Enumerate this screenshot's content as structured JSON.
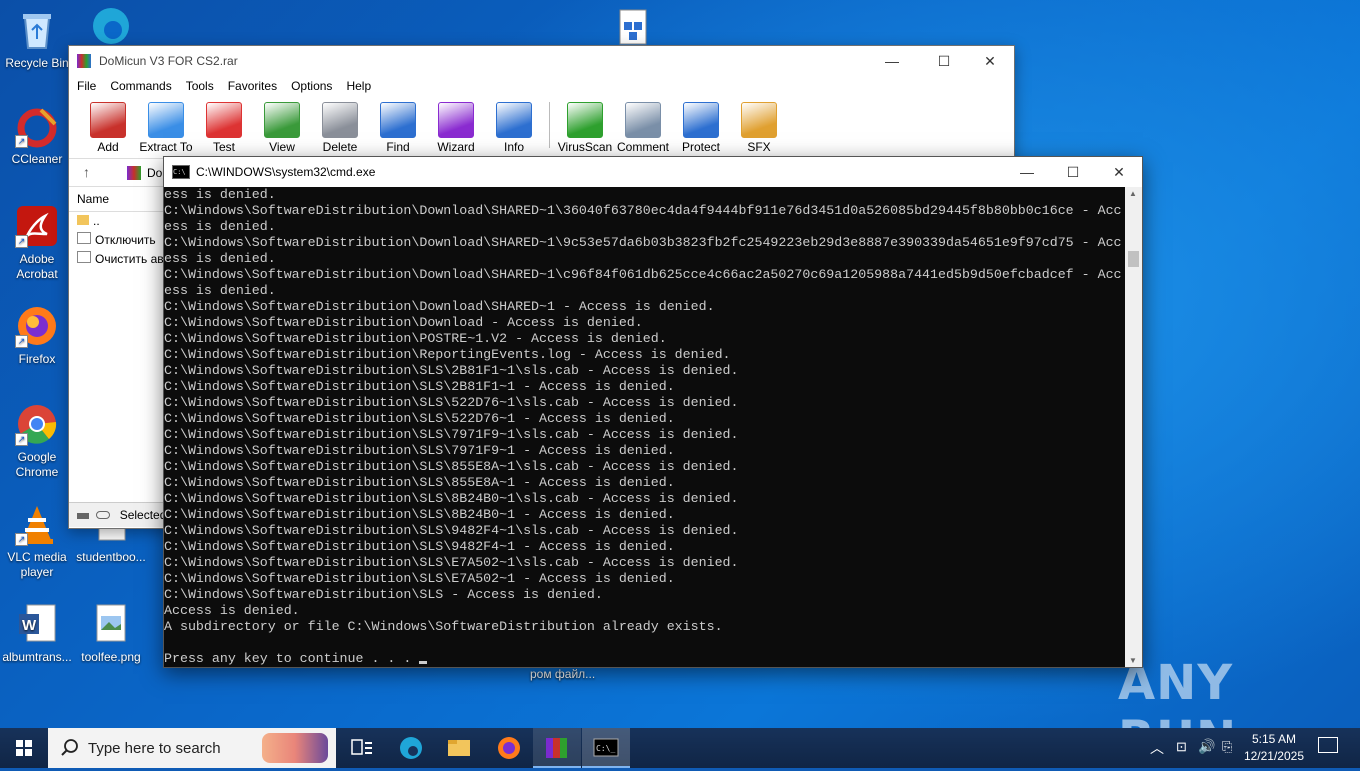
{
  "desktop": {
    "icons": [
      {
        "label": "Recycle Bin",
        "color": "#9fd0ff"
      },
      {
        "label": "CCleaner",
        "color": "#d32b2b"
      },
      {
        "label": "Adobe Acrobat",
        "color": "#c4170f"
      },
      {
        "label": "Firefox",
        "color": "#ff7a1a"
      },
      {
        "label": "Google Chrome",
        "color": "#34a853"
      },
      {
        "label": "VLC media player",
        "color": "#f08000"
      },
      {
        "label": "studentboo...",
        "color": "#ffffff"
      },
      {
        "label": "albumtrans...",
        "color": "#2b579a"
      },
      {
        "label": "toolfee.png",
        "color": "#ffffff"
      }
    ],
    "bg_caption": "ром файл...",
    "watermark": "ANY RUN"
  },
  "winrar": {
    "title": "DoMicun V3 FOR CS2.rar",
    "menu": [
      "File",
      "Commands",
      "Tools",
      "Favorites",
      "Options",
      "Help"
    ],
    "toolbar": [
      {
        "label": "Add",
        "icon": "add-archive-icon",
        "color": "#c8312b"
      },
      {
        "label": "Extract To",
        "icon": "extract-folder-icon",
        "color": "#3a8ee6"
      },
      {
        "label": "Test",
        "icon": "test-clipboard-icon",
        "color": "#d33"
      },
      {
        "label": "View",
        "icon": "view-book-icon",
        "color": "#3a9a3a"
      },
      {
        "label": "Delete",
        "icon": "trash-icon",
        "color": "#8a8f99"
      },
      {
        "label": "Find",
        "icon": "magnifier-icon",
        "color": "#2d6fd0"
      },
      {
        "label": "Wizard",
        "icon": "wand-icon",
        "color": "#8a2bd0"
      },
      {
        "label": "Info",
        "icon": "info-icon",
        "color": "#2d6fd0"
      },
      {
        "label": "VirusScan",
        "icon": "virus-scan-icon",
        "color": "#2ea02e"
      },
      {
        "label": "Comment",
        "icon": "comment-icon",
        "color": "#7a8fa8"
      },
      {
        "label": "Protect",
        "icon": "shield-icon",
        "color": "#2d6fd0"
      },
      {
        "label": "SFX",
        "icon": "sfx-box-icon",
        "color": "#e0a030"
      }
    ],
    "address_text": "Do",
    "list_header": "Name",
    "rows": [
      "..",
      "Отключить",
      "Очистить авт"
    ],
    "status": "Selected"
  },
  "cmd": {
    "title": "C:\\WINDOWS\\system32\\cmd.exe",
    "lines": [
      "ess is denied.",
      "C:\\Windows\\SoftwareDistribution\\Download\\SHARED~1\\36040f63780ec4da4f9444bf911e76d3451d0a526085bd29445f8b80bb0c16ce - Acc",
      "ess is denied.",
      "C:\\Windows\\SoftwareDistribution\\Download\\SHARED~1\\9c53e57da6b03b3823fb2fc2549223eb29d3e8887e390339da54651e9f97cd75 - Acc",
      "ess is denied.",
      "C:\\Windows\\SoftwareDistribution\\Download\\SHARED~1\\c96f84f061db625cce4c66ac2a50270c69a1205988a7441ed5b9d50efcbadcef - Acc",
      "ess is denied.",
      "C:\\Windows\\SoftwareDistribution\\Download\\SHARED~1 - Access is denied.",
      "C:\\Windows\\SoftwareDistribution\\Download - Access is denied.",
      "C:\\Windows\\SoftwareDistribution\\POSTRE~1.V2 - Access is denied.",
      "C:\\Windows\\SoftwareDistribution\\ReportingEvents.log - Access is denied.",
      "C:\\Windows\\SoftwareDistribution\\SLS\\2B81F1~1\\sls.cab - Access is denied.",
      "C:\\Windows\\SoftwareDistribution\\SLS\\2B81F1~1 - Access is denied.",
      "C:\\Windows\\SoftwareDistribution\\SLS\\522D76~1\\sls.cab - Access is denied.",
      "C:\\Windows\\SoftwareDistribution\\SLS\\522D76~1 - Access is denied.",
      "C:\\Windows\\SoftwareDistribution\\SLS\\7971F9~1\\sls.cab - Access is denied.",
      "C:\\Windows\\SoftwareDistribution\\SLS\\7971F9~1 - Access is denied.",
      "C:\\Windows\\SoftwareDistribution\\SLS\\855E8A~1\\sls.cab - Access is denied.",
      "C:\\Windows\\SoftwareDistribution\\SLS\\855E8A~1 - Access is denied.",
      "C:\\Windows\\SoftwareDistribution\\SLS\\8B24B0~1\\sls.cab - Access is denied.",
      "C:\\Windows\\SoftwareDistribution\\SLS\\8B24B0~1 - Access is denied.",
      "C:\\Windows\\SoftwareDistribution\\SLS\\9482F4~1\\sls.cab - Access is denied.",
      "C:\\Windows\\SoftwareDistribution\\SLS\\9482F4~1 - Access is denied.",
      "C:\\Windows\\SoftwareDistribution\\SLS\\E7A502~1\\sls.cab - Access is denied.",
      "C:\\Windows\\SoftwareDistribution\\SLS\\E7A502~1 - Access is denied.",
      "C:\\Windows\\SoftwareDistribution\\SLS - Access is denied.",
      "Access is denied.",
      "A subdirectory or file C:\\Windows\\SoftwareDistribution already exists.",
      "",
      "Press any key to continue . . . "
    ]
  },
  "taskbar": {
    "search_placeholder": "Type here to search",
    "apps": [
      "task-view-icon",
      "edge-icon",
      "file-explorer-icon",
      "firefox-icon",
      "winrar-icon",
      "cmd-icon"
    ],
    "time": "5:15 AM",
    "date": "12/21/2025"
  }
}
